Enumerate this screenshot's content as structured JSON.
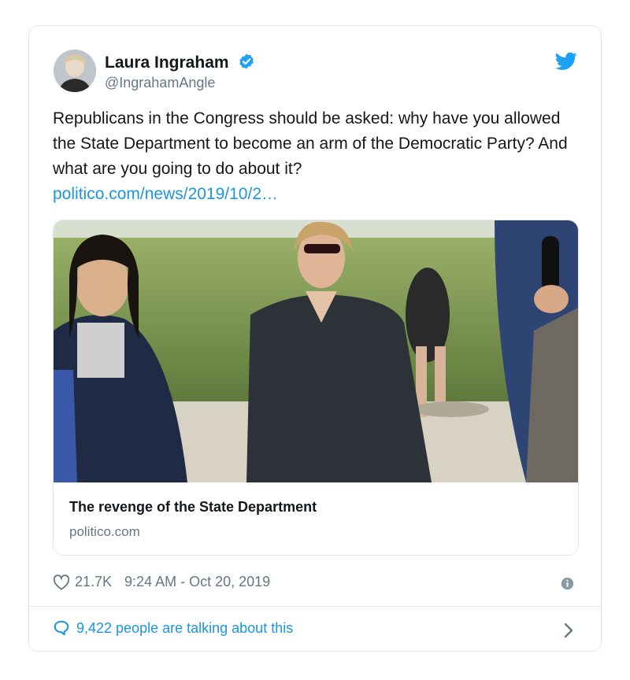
{
  "author": {
    "name": "Laura Ingraham",
    "handle": "@IngrahamAngle"
  },
  "tweet": {
    "text": "Republicans in the Congress should be asked:  why have you allowed the State Department to become an arm of the Democratic Party?  And what are you going to do about it?",
    "link_text": "politico.com/news/2019/10/2…"
  },
  "link_card": {
    "title": "The revenge of the State Department",
    "domain": "politico.com"
  },
  "meta": {
    "likes": "21.7K",
    "datetime": "9:24 AM - Oct 20, 2019"
  },
  "conversation": {
    "label": "9,422 people are talking about this"
  },
  "colors": {
    "accent": "#1b95e0",
    "text_primary": "#14171a",
    "text_secondary": "#657786",
    "border": "#e1e8ed"
  },
  "icons": [
    "verified-badge-icon",
    "twitter-bird-icon",
    "heart-icon",
    "info-icon",
    "speech-bubble-icon",
    "chevron-right-icon"
  ]
}
